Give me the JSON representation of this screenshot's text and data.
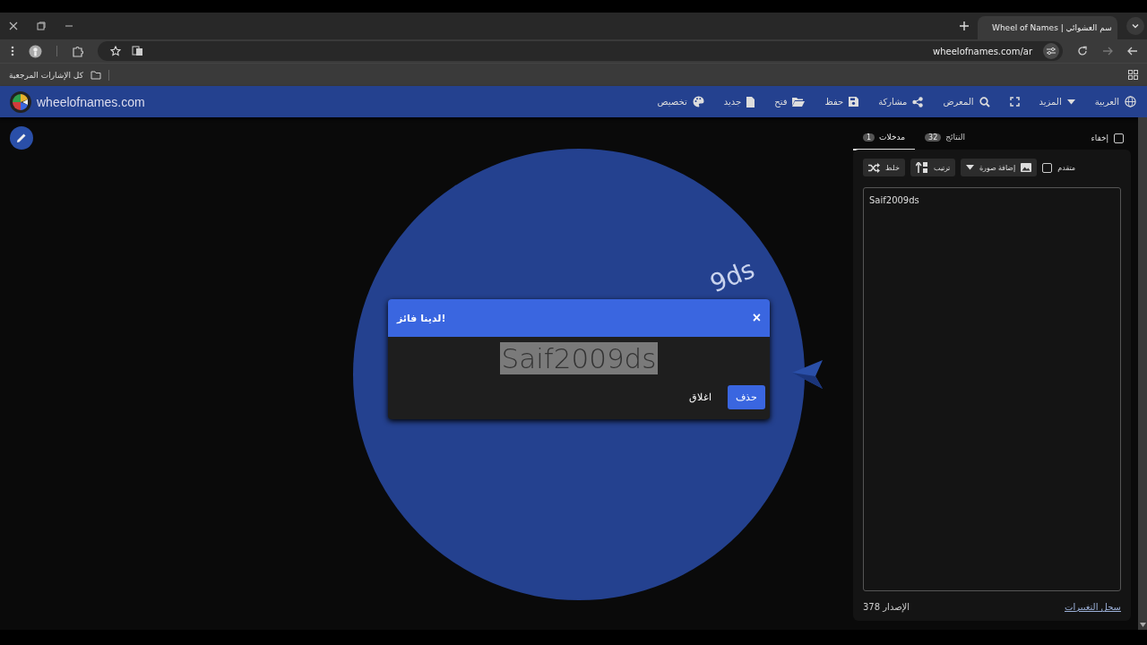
{
  "browser": {
    "tab_title": "Wheel of Names | سم العشوائي",
    "url": "wheelofnames.com/ar",
    "bookmarks_folder": "كل الإشارات المرجعية"
  },
  "header": {
    "logo_text": "wheelofnames.com",
    "nav": [
      {
        "kind": "globe",
        "label": "العربية"
      },
      {
        "kind": "caret",
        "label": "المزيد"
      },
      {
        "kind": "fullscreen"
      },
      {
        "kind": "search",
        "label": "المعرض"
      },
      {
        "kind": "share",
        "label": "مشاركة"
      },
      {
        "kind": "save",
        "label": "حفظ"
      },
      {
        "kind": "folder",
        "label": "فتح"
      },
      {
        "kind": "file",
        "label": "جديد"
      },
      {
        "kind": "palette",
        "label": "تخصيص"
      }
    ]
  },
  "wheel": {
    "visible_label": "9ds"
  },
  "dialog": {
    "title": "لدينا فائز!",
    "close": "×",
    "winner": "Saif2009ds",
    "buttons": [
      {
        "kind": "primary",
        "label": "حذف"
      },
      {
        "kind": "text",
        "label": "اغلاق"
      }
    ]
  },
  "sidebar": {
    "hide": {
      "label": "إخفاء",
      "checked": false
    },
    "tabs": [
      {
        "label": "النتائج",
        "count": "32",
        "selected": false
      },
      {
        "label": "مدخلات",
        "count": "1",
        "selected": true
      }
    ],
    "advanced": {
      "label": "متقدم",
      "checked": false
    },
    "tools": [
      {
        "kind": "image",
        "label": "إضافة صورة"
      },
      {
        "kind": "sort",
        "label": "ترتيب"
      },
      {
        "kind": "shuffle",
        "label": "خلط"
      }
    ],
    "entries": "Saif2009ds",
    "version": "الإصدار 378",
    "changelog": "سجل التغييرات"
  }
}
